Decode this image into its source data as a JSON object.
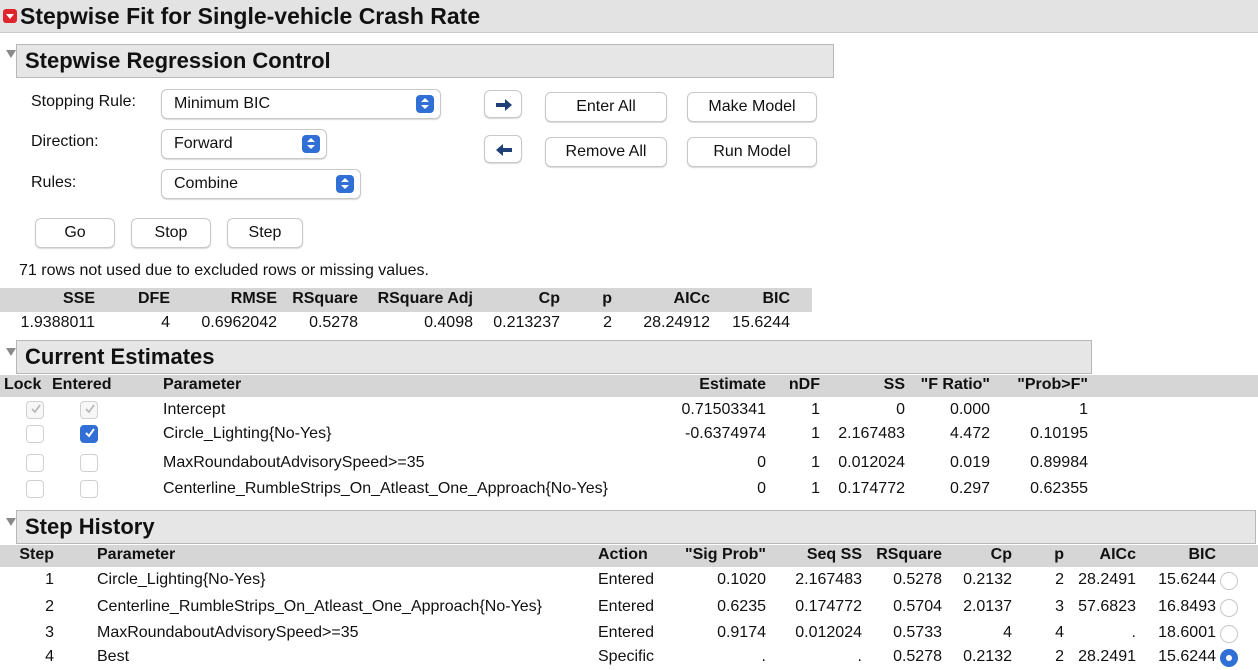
{
  "window_title": "Stepwise Fit for Single-vehicle Crash Rate",
  "control": {
    "title": "Stepwise Regression Control",
    "stopping_rule_label": "Stopping Rule:",
    "stopping_rule_value": "Minimum BIC",
    "direction_label": "Direction:",
    "direction_value": "Forward",
    "rules_label": "Rules:",
    "rules_value": "Combine",
    "enter_all": "Enter All",
    "remove_all": "Remove All",
    "make_model": "Make Model",
    "run_model": "Run Model",
    "go": "Go",
    "stop": "Stop",
    "step": "Step",
    "note": "71 rows not used due to excluded rows or missing values."
  },
  "stats": {
    "headers": [
      "SSE",
      "DFE",
      "RMSE",
      "RSquare",
      "RSquare Adj",
      "Cp",
      "p",
      "AICc",
      "BIC"
    ],
    "values": [
      "1.9388011",
      "4",
      "0.6962042",
      "0.5278",
      "0.4098",
      "0.213237",
      "2",
      "28.24912",
      "15.6244"
    ]
  },
  "estimates": {
    "title": "Current Estimates",
    "headers": [
      "Lock",
      "Entered",
      "Parameter",
      "Estimate",
      "nDF",
      "SS",
      "\"F Ratio\"",
      "\"Prob>F\""
    ],
    "rows": [
      {
        "param": "Intercept",
        "estimate": "0.71503341",
        "ndf": "1",
        "ss": "0",
        "f": "0.000",
        "p": "1",
        "lock": "locked",
        "entered": "locked"
      },
      {
        "param": "Circle_Lighting{No-Yes}",
        "estimate": "-0.6374974",
        "ndf": "1",
        "ss": "2.167483",
        "f": "4.472",
        "p": "0.10195",
        "lock": "off",
        "entered": "checked"
      },
      {
        "param": "MaxRoundaboutAdvisorySpeed>=35",
        "estimate": "0",
        "ndf": "1",
        "ss": "0.012024",
        "f": "0.019",
        "p": "0.89984",
        "lock": "off",
        "entered": "off"
      },
      {
        "param": "Centerline_RumbleStrips_On_Atleast_One_Approach{No-Yes}",
        "estimate": "0",
        "ndf": "1",
        "ss": "0.174772",
        "f": "0.297",
        "p": "0.62355",
        "lock": "off",
        "entered": "off"
      }
    ]
  },
  "history": {
    "title": "Step History",
    "headers": [
      "Step",
      "Parameter",
      "Action",
      "\"Sig Prob\"",
      "Seq SS",
      "RSquare",
      "Cp",
      "p",
      "AICc",
      "BIC"
    ],
    "rows": [
      {
        "step": "1",
        "param": "Circle_Lighting{No-Yes}",
        "action": "Entered",
        "sig": "0.1020",
        "seq": "2.167483",
        "rsq": "0.5278",
        "cp": "0.2132",
        "p": "2",
        "aicc": "28.2491",
        "bic": "15.6244",
        "selected": false
      },
      {
        "step": "2",
        "param": "Centerline_RumbleStrips_On_Atleast_One_Approach{No-Yes}",
        "action": "Entered",
        "sig": "0.6235",
        "seq": "0.174772",
        "rsq": "0.5704",
        "cp": "2.0137",
        "p": "3",
        "aicc": "57.6823",
        "bic": "16.8493",
        "selected": false
      },
      {
        "step": "3",
        "param": "MaxRoundaboutAdvisorySpeed>=35",
        "action": "Entered",
        "sig": "0.9174",
        "seq": "0.012024",
        "rsq": "0.5733",
        "cp": "4",
        "p": "4",
        "aicc": ".",
        "bic": "18.6001",
        "selected": false
      },
      {
        "step": "4",
        "param": "Best",
        "action": "Specific",
        "sig": ".",
        "seq": ".",
        "rsq": "0.5278",
        "cp": "0.2132",
        "p": "2",
        "aicc": "28.2491",
        "bic": "15.6244",
        "selected": true
      }
    ]
  }
}
